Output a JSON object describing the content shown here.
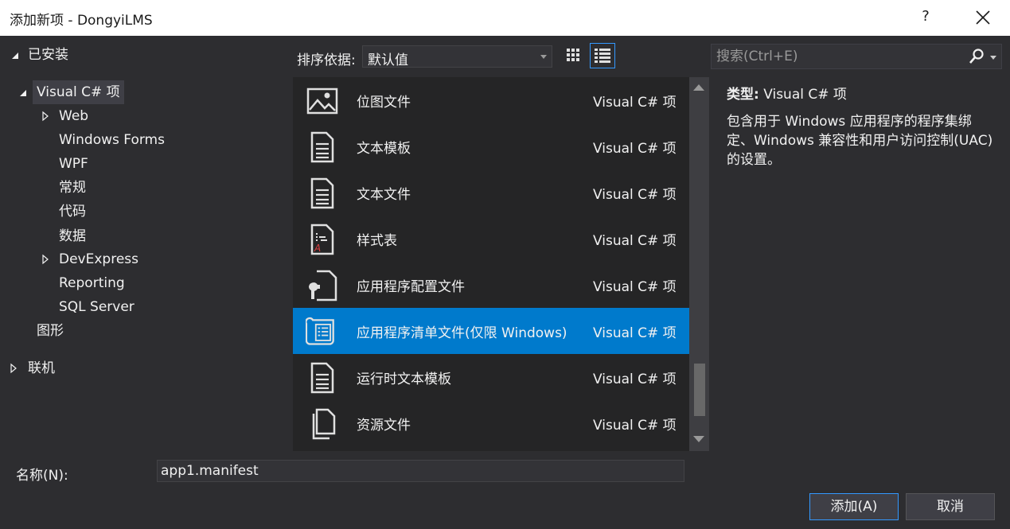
{
  "window": {
    "title": "添加新项 - DongyiLMS",
    "help": "?"
  },
  "tree": {
    "installed": "已安装",
    "visual_cs": "Visual C# 项",
    "web": "Web",
    "winforms": "Windows Forms",
    "wpf": "WPF",
    "general": "常规",
    "code": "代码",
    "data": "数据",
    "devexpress": "DevExpress",
    "reporting": "Reporting",
    "sql_server": "SQL Server",
    "graphics": "图形",
    "online": "联机"
  },
  "sort": {
    "label": "排序依据:",
    "value": "默认值"
  },
  "search": {
    "placeholder": "搜索(Ctrl+E)"
  },
  "items": [
    {
      "name": "位图文件",
      "category": "Visual C# 项",
      "icon": "bitmap-icon"
    },
    {
      "name": "文本模板",
      "category": "Visual C# 项",
      "icon": "text-template-icon"
    },
    {
      "name": "文本文件",
      "category": "Visual C# 项",
      "icon": "text-file-icon"
    },
    {
      "name": "样式表",
      "category": "Visual C# 项",
      "icon": "stylesheet-icon"
    },
    {
      "name": "应用程序配置文件",
      "category": "Visual C# 项",
      "icon": "config-file-icon"
    },
    {
      "name": "应用程序清单文件(仅限 Windows)",
      "category": "Visual C# 项",
      "icon": "manifest-icon",
      "selected": true
    },
    {
      "name": "运行时文本模板",
      "category": "Visual C# 项",
      "icon": "runtime-template-icon"
    },
    {
      "name": "资源文件",
      "category": "Visual C# 项",
      "icon": "resource-file-icon"
    }
  ],
  "details": {
    "type_key": "类型:",
    "type_value": "Visual C# 项",
    "description": "包含用于 Windows 应用程序的程序集绑定、Windows 兼容性和用户访问控制(UAC)的设置。"
  },
  "footer": {
    "name_label": "名称(N):",
    "name_value": "app1.manifest",
    "add_label": "添加(A)",
    "cancel_label": "取消"
  },
  "colors": {
    "background": "#2d2d30",
    "list_background": "#252526",
    "selection": "#007acc",
    "accent_border": "#3399ff"
  }
}
